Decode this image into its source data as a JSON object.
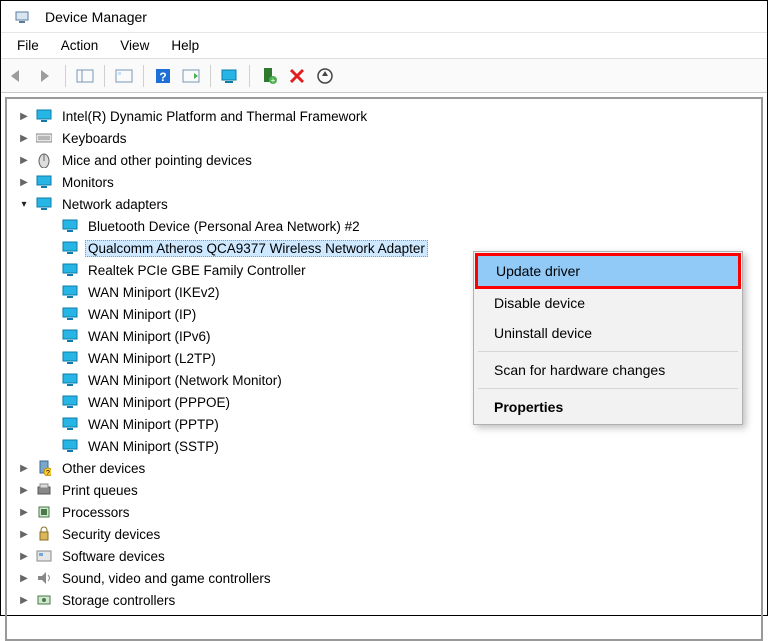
{
  "window": {
    "title": "Device Manager"
  },
  "menu": {
    "file": "File",
    "action": "Action",
    "view": "View",
    "help": "Help"
  },
  "tree": {
    "intel_platform": "Intel(R) Dynamic Platform and Thermal Framework",
    "keyboards": "Keyboards",
    "mice": "Mice and other pointing devices",
    "monitors": "Monitors",
    "network_adapters": "Network adapters",
    "na_children": {
      "bt": "Bluetooth Device (Personal Area Network) #2",
      "qca": "Qualcomm Atheros QCA9377 Wireless Network Adapter",
      "realtek": "Realtek PCIe GBE Family Controller",
      "wan_ikev2": "WAN Miniport (IKEv2)",
      "wan_ip": "WAN Miniport (IP)",
      "wan_ipv6": "WAN Miniport (IPv6)",
      "wan_l2tp": "WAN Miniport (L2TP)",
      "wan_netmon": "WAN Miniport (Network Monitor)",
      "wan_pppoe": "WAN Miniport (PPPOE)",
      "wan_pptp": "WAN Miniport (PPTP)",
      "wan_sstp": "WAN Miniport (SSTP)"
    },
    "other_devices": "Other devices",
    "print_queues": "Print queues",
    "processors": "Processors",
    "security_devices": "Security devices",
    "software_devices": "Software devices",
    "sound": "Sound, video and game controllers",
    "storage": "Storage controllers"
  },
  "context_menu": {
    "update": "Update driver",
    "disable": "Disable device",
    "uninstall": "Uninstall device",
    "scan": "Scan for hardware changes",
    "properties": "Properties"
  },
  "icons": {
    "computer": "computer-icon",
    "monitor": "monitor-icon",
    "network": "network-icon",
    "keyboard": "keyboard-icon",
    "mouse": "mouse-icon",
    "other": "other-device-icon",
    "printer": "printer-icon",
    "processor": "processor-icon",
    "security": "security-icon",
    "software": "software-icon",
    "sound": "sound-icon",
    "storage": "storage-icon"
  }
}
